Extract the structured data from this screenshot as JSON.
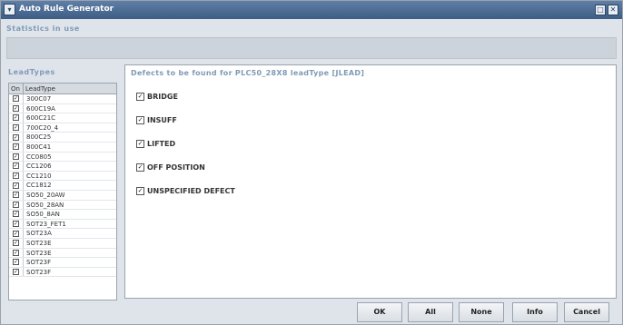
{
  "window": {
    "title": "Auto Rule Generator",
    "menu_icon": "▾",
    "maximize_icon": "□",
    "close_icon": "✕"
  },
  "stats": {
    "label": "Statistics in use"
  },
  "leadtypes": {
    "label": "LeadTypes",
    "col_on": "On",
    "col_leadtype": "LeadType",
    "items": [
      {
        "name": "300C07",
        "checked": true
      },
      {
        "name": "600C19A",
        "checked": true
      },
      {
        "name": "600C21C",
        "checked": true
      },
      {
        "name": "700C20_4",
        "checked": true
      },
      {
        "name": "800C25",
        "checked": true
      },
      {
        "name": "800C41",
        "checked": true
      },
      {
        "name": "CC0805",
        "checked": true
      },
      {
        "name": "CC1206",
        "checked": true
      },
      {
        "name": "CC1210",
        "checked": true
      },
      {
        "name": "CC1812",
        "checked": true
      },
      {
        "name": "SO50_20AW",
        "checked": true
      },
      {
        "name": "SO50_28AN",
        "checked": true
      },
      {
        "name": "SO50_8AN",
        "checked": true
      },
      {
        "name": "SOT23_FET1",
        "checked": true
      },
      {
        "name": "SOT23A",
        "checked": true
      },
      {
        "name": "SOT23E",
        "checked": true
      },
      {
        "name": "SOT23E",
        "checked": true
      },
      {
        "name": "SOT23F",
        "checked": true
      },
      {
        "name": "SOT23F",
        "checked": true
      }
    ]
  },
  "defects": {
    "header": "Defects to be found for PLC50_28X8 leadType [JLEAD]",
    "items": [
      {
        "label": "BRIDGE",
        "checked": true
      },
      {
        "label": "INSUFF",
        "checked": true
      },
      {
        "label": "LIFTED",
        "checked": true
      },
      {
        "label": "OFF POSITION",
        "checked": true
      },
      {
        "label": "UNSPECIFIED DEFECT",
        "checked": true
      }
    ]
  },
  "buttons": {
    "ok": "OK",
    "all": "All",
    "none": "None",
    "info": "Info",
    "cancel": "Cancel"
  },
  "colors": {
    "titlebar": "#4d6e96",
    "section_label": "#7f9ab6",
    "window_bg": "#dfe4ea"
  }
}
